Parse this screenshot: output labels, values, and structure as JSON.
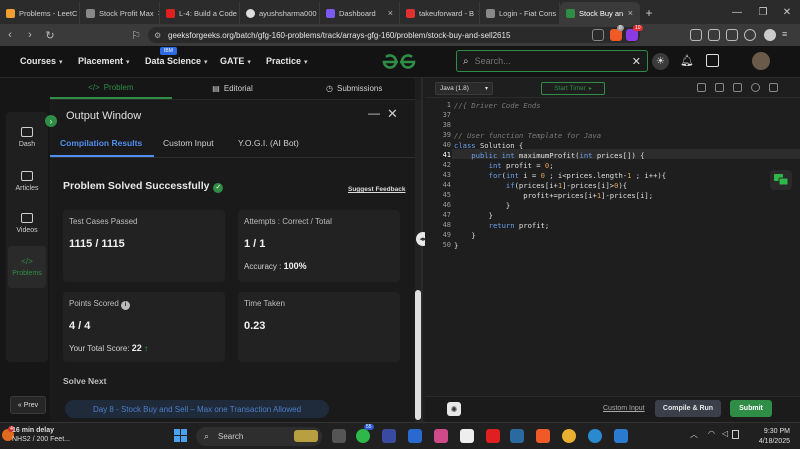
{
  "browser": {
    "tabs": [
      {
        "label": "Problems - LeetC",
        "color": "#f0a030"
      },
      {
        "label": "Stock Profit Max",
        "color": "#888888"
      },
      {
        "label": "L-4: Build a Code",
        "color": "#e02020"
      },
      {
        "label": "ayushsharma000",
        "color": "#dddddd"
      },
      {
        "label": "Dashboard",
        "color": "#7a5af0"
      },
      {
        "label": "takeuforward - B",
        "color": "#e03030"
      },
      {
        "label": "Login - Fiat Cons",
        "color": "#888888"
      },
      {
        "label": "Stock Buy an",
        "color": "#2f8d46"
      }
    ],
    "url": "geeksforgeeks.org/batch/gfg-160-problems/track/arrays-gfg-160/problem/stock-buy-and-sell2615",
    "brave_badge": "8",
    "notif_badge": "10"
  },
  "header": {
    "nav": [
      "Courses",
      "Placement",
      "Data Science",
      "GATE",
      "Practice"
    ],
    "ibm_badge": "IBM",
    "logo": "GG",
    "search_placeholder": "Search..."
  },
  "problem_tabs": [
    "Problem",
    "Editorial",
    "Submissions"
  ],
  "sidebar": {
    "items": [
      "Dash",
      "Articles",
      "Videos",
      "Problems"
    ],
    "prev": "Prev"
  },
  "output": {
    "title": "Output Window",
    "tabs": [
      "Compilation Results",
      "Custom Input",
      "Y.O.G.I. (AI Bot)"
    ],
    "status": "Problem Solved Successfully",
    "feedback": "Suggest Feedback",
    "cards": {
      "tests_label": "Test Cases Passed",
      "tests_value": "1115 / 1115",
      "attempts_label": "Attempts : Correct / Total",
      "attempts_value": "1 / 1",
      "accuracy_label": "Accuracy :",
      "accuracy_value": "100%",
      "points_label": "Points Scored",
      "points_value": "4 / 4",
      "total_label": "Your Total Score:",
      "total_value": "22",
      "time_label": "Time Taken",
      "time_value": "0.23"
    },
    "solve_next": "Solve Next",
    "next_problem": "Day 8 - Stock Buy and Sell – Max one Transaction Allowed"
  },
  "editor": {
    "language": "Java (1.8)",
    "timer": "Start Timer",
    "line_numbers": [
      "1",
      "37",
      "38",
      "39",
      "40",
      "41",
      "42",
      "43",
      "44",
      "45",
      "46",
      "47",
      "48",
      "49",
      "50"
    ],
    "code": {
      "l1": "//{ Driver Code Ends",
      "l39": "// User function Template for Java",
      "l40a": "class",
      "l40b": " Solution {",
      "l41a": "    public int ",
      "l41b": "maximumProfit(",
      "l41c": "int",
      "l41d": " prices[]) {",
      "l42a": "        int ",
      "l42b": "profit = ",
      "l42c": "0",
      "l42d": ";",
      "l43a": "        for",
      "l43b": "(",
      "l43c": "int ",
      "l43d": "i = ",
      "l43e": "0",
      "l43f": " ; i<prices.length-",
      "l43g": "1",
      "l43h": " ; i++){",
      "l44a": "            if",
      "l44b": "(prices[i+",
      "l44c": "1",
      "l44d": "]-prices[i]>",
      "l44e": "0",
      "l44f": "){",
      "l45a": "                profit+=prices[i+",
      "l45b": "1",
      "l45c": "]-prices[i];",
      "l46": "            }",
      "l47": "        }",
      "l48a": "        return",
      "l48b": " profit;",
      "l49": "    }",
      "l50": "}"
    },
    "custom_input": "Custom Input",
    "compile_run": "Compile & Run",
    "submit": "Submit"
  },
  "taskbar": {
    "weather_title": "16 min delay",
    "weather_sub": "NHS2 / 200 Feet...",
    "weather_badge": "4",
    "search": "Search",
    "whatsapp_badge": "55",
    "time": "9:30 PM",
    "date": "4/18/2025"
  }
}
